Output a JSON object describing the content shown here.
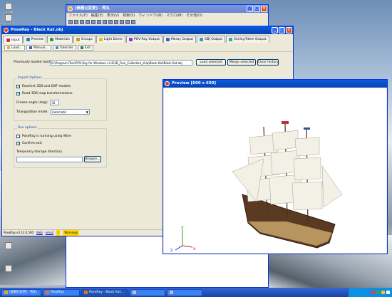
{
  "desktop": {
    "icons": [
      {
        "label": "ゴミ箱"
      },
      {
        "label": "ショートカット"
      },
      {
        "label": ""
      },
      {
        "label": ""
      },
      {
        "label": ""
      },
      {
        "label": ""
      },
      {
        "label": ""
      },
      {
        "label": ""
      }
    ]
  },
  "back_window": {
    "title": "(無題)[変更] - 秀丸",
    "menu": [
      "ファイル(F)",
      "編集(E)",
      "表示(V)",
      "検索(S)",
      "ウィンドウ(W)",
      "マクロ(M)",
      "その他(O)"
    ]
  },
  "main_window": {
    "title": "PoseRay - Black Kat.obj",
    "tabs": [
      {
        "label": "Input",
        "color": "#d03030"
      },
      {
        "label": "Preview",
        "color": "#2a7ad0"
      },
      {
        "label": "Materials",
        "color": "#2aa030"
      },
      {
        "label": "Groups",
        "color": "#c0a020"
      },
      {
        "label": "Light Dome",
        "color": "#e0c020"
      },
      {
        "label": "POV-Ray Output",
        "color": "#8040c0"
      },
      {
        "label": "Moray Output",
        "color": "#4060c0"
      },
      {
        "label": "OBJ Output",
        "color": "#4090c0"
      },
      {
        "label": "Smiley/Stem Output",
        "color": "#40a0a0"
      }
    ],
    "toolbar": [
      "Load...",
      "Manual...",
      "Tutorials",
      "Exit"
    ],
    "previously_loaded_label": "Previously loaded models:",
    "model_path": "D:\\Program Files\\POV-Ray for Windows v3.6\\3D_Free_Collection_ship\\Black Kat\\Black Kat.obj",
    "load_selected": "Load selected",
    "merge_selected": "Merge selected",
    "clear_history": "Clear history",
    "import_options": {
      "title": "Import Options",
      "reorient": "Reorient 3DS and DXF models",
      "read_3ds": "Read 3DS map transformations",
      "crease_label": "Crease angle (deg):",
      "crease_value": "35",
      "triangulation_label": "Triangulation mode:",
      "triangulation_value": "Automatic"
    },
    "run_options": {
      "title": "Run options",
      "povray_running": "PoseRay is running using Wine",
      "confirm_exit": "Confirm exit",
      "temp_dir_label": "Temporary storage directory",
      "temp_dir_value": "",
      "browse": "Browse..."
    },
    "status": {
      "version": "PoseRay v3.13.0.500",
      "web": "Web",
      "email": "email",
      "warnings": "Warnings"
    }
  },
  "preview_window": {
    "title": "Preview [600 x 600]",
    "axes": {
      "x": "x",
      "y": "y",
      "z": "z"
    }
  },
  "taskbar": {
    "items": [
      {
        "label": "(無題)[変更] - 秀丸"
      },
      {
        "label": "PoseRay"
      },
      {
        "label": "PoseRay - Black Kat..."
      },
      {
        "label": ""
      },
      {
        "label": ""
      }
    ],
    "tray_icons": [
      "#e04040",
      "#40a040",
      "#f0c040",
      "#ffffff"
    ]
  }
}
